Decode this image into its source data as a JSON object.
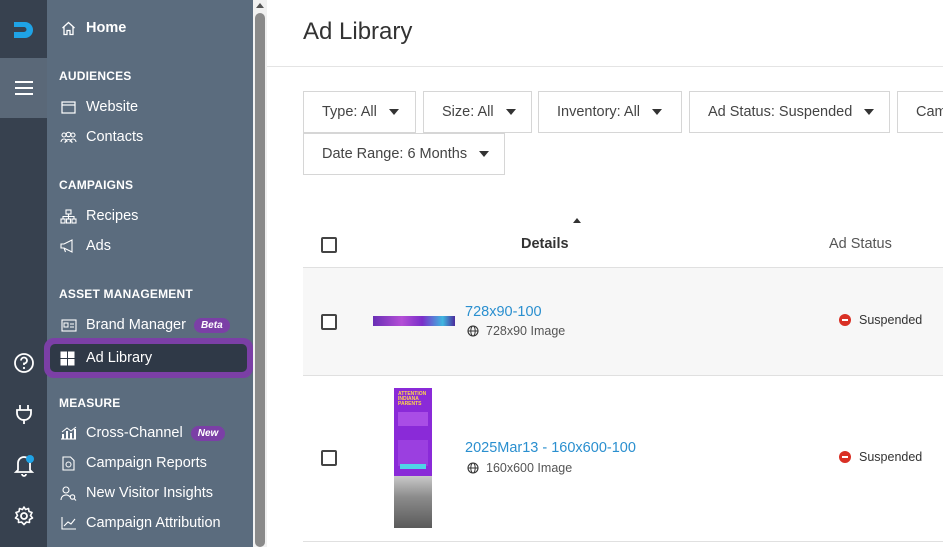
{
  "sidebar": {
    "home": "Home",
    "sections": [
      {
        "title": "AUDIENCES"
      },
      {
        "title": "CAMPAIGNS"
      },
      {
        "title": "ASSET MANAGEMENT"
      },
      {
        "title": "MEASURE"
      }
    ],
    "items": {
      "website": "Website",
      "contacts": "Contacts",
      "recipes": "Recipes",
      "ads": "Ads",
      "brand_manager": "Brand Manager",
      "brand_manager_badge": "Beta",
      "ad_library": "Ad Library",
      "cross_channel": "Cross-Channel",
      "cross_channel_badge": "New",
      "campaign_reports": "Campaign Reports",
      "new_visitor_insights": "New Visitor Insights",
      "campaign_attribution": "Campaign Attribution"
    }
  },
  "main": {
    "title": "Ad Library",
    "filters": [
      {
        "label": "Type: All"
      },
      {
        "label": "Size: All"
      },
      {
        "label": "Inventory: All"
      },
      {
        "label": "Ad Status: Suspended"
      },
      {
        "label": "Cam"
      },
      {
        "label": "Date Range: 6 Months"
      }
    ],
    "table": {
      "headers": {
        "details": "Details",
        "ad_status": "Ad Status"
      },
      "rows": [
        {
          "name": "728x90-100",
          "size": "728x90 Image",
          "status": "Suspended"
        },
        {
          "name": "2025Mar13 - 160x600-100",
          "size": "160x600 Image",
          "status": "Suspended"
        }
      ]
    },
    "thumb_text": "ATTENTION INDIANA PARENTS"
  },
  "colors": {
    "rail": "#37414f",
    "sidebar": "#5b6c7e",
    "active_outline": "#7b3fa6",
    "link": "#2a8fcf",
    "status_suspended": "#d93025"
  }
}
